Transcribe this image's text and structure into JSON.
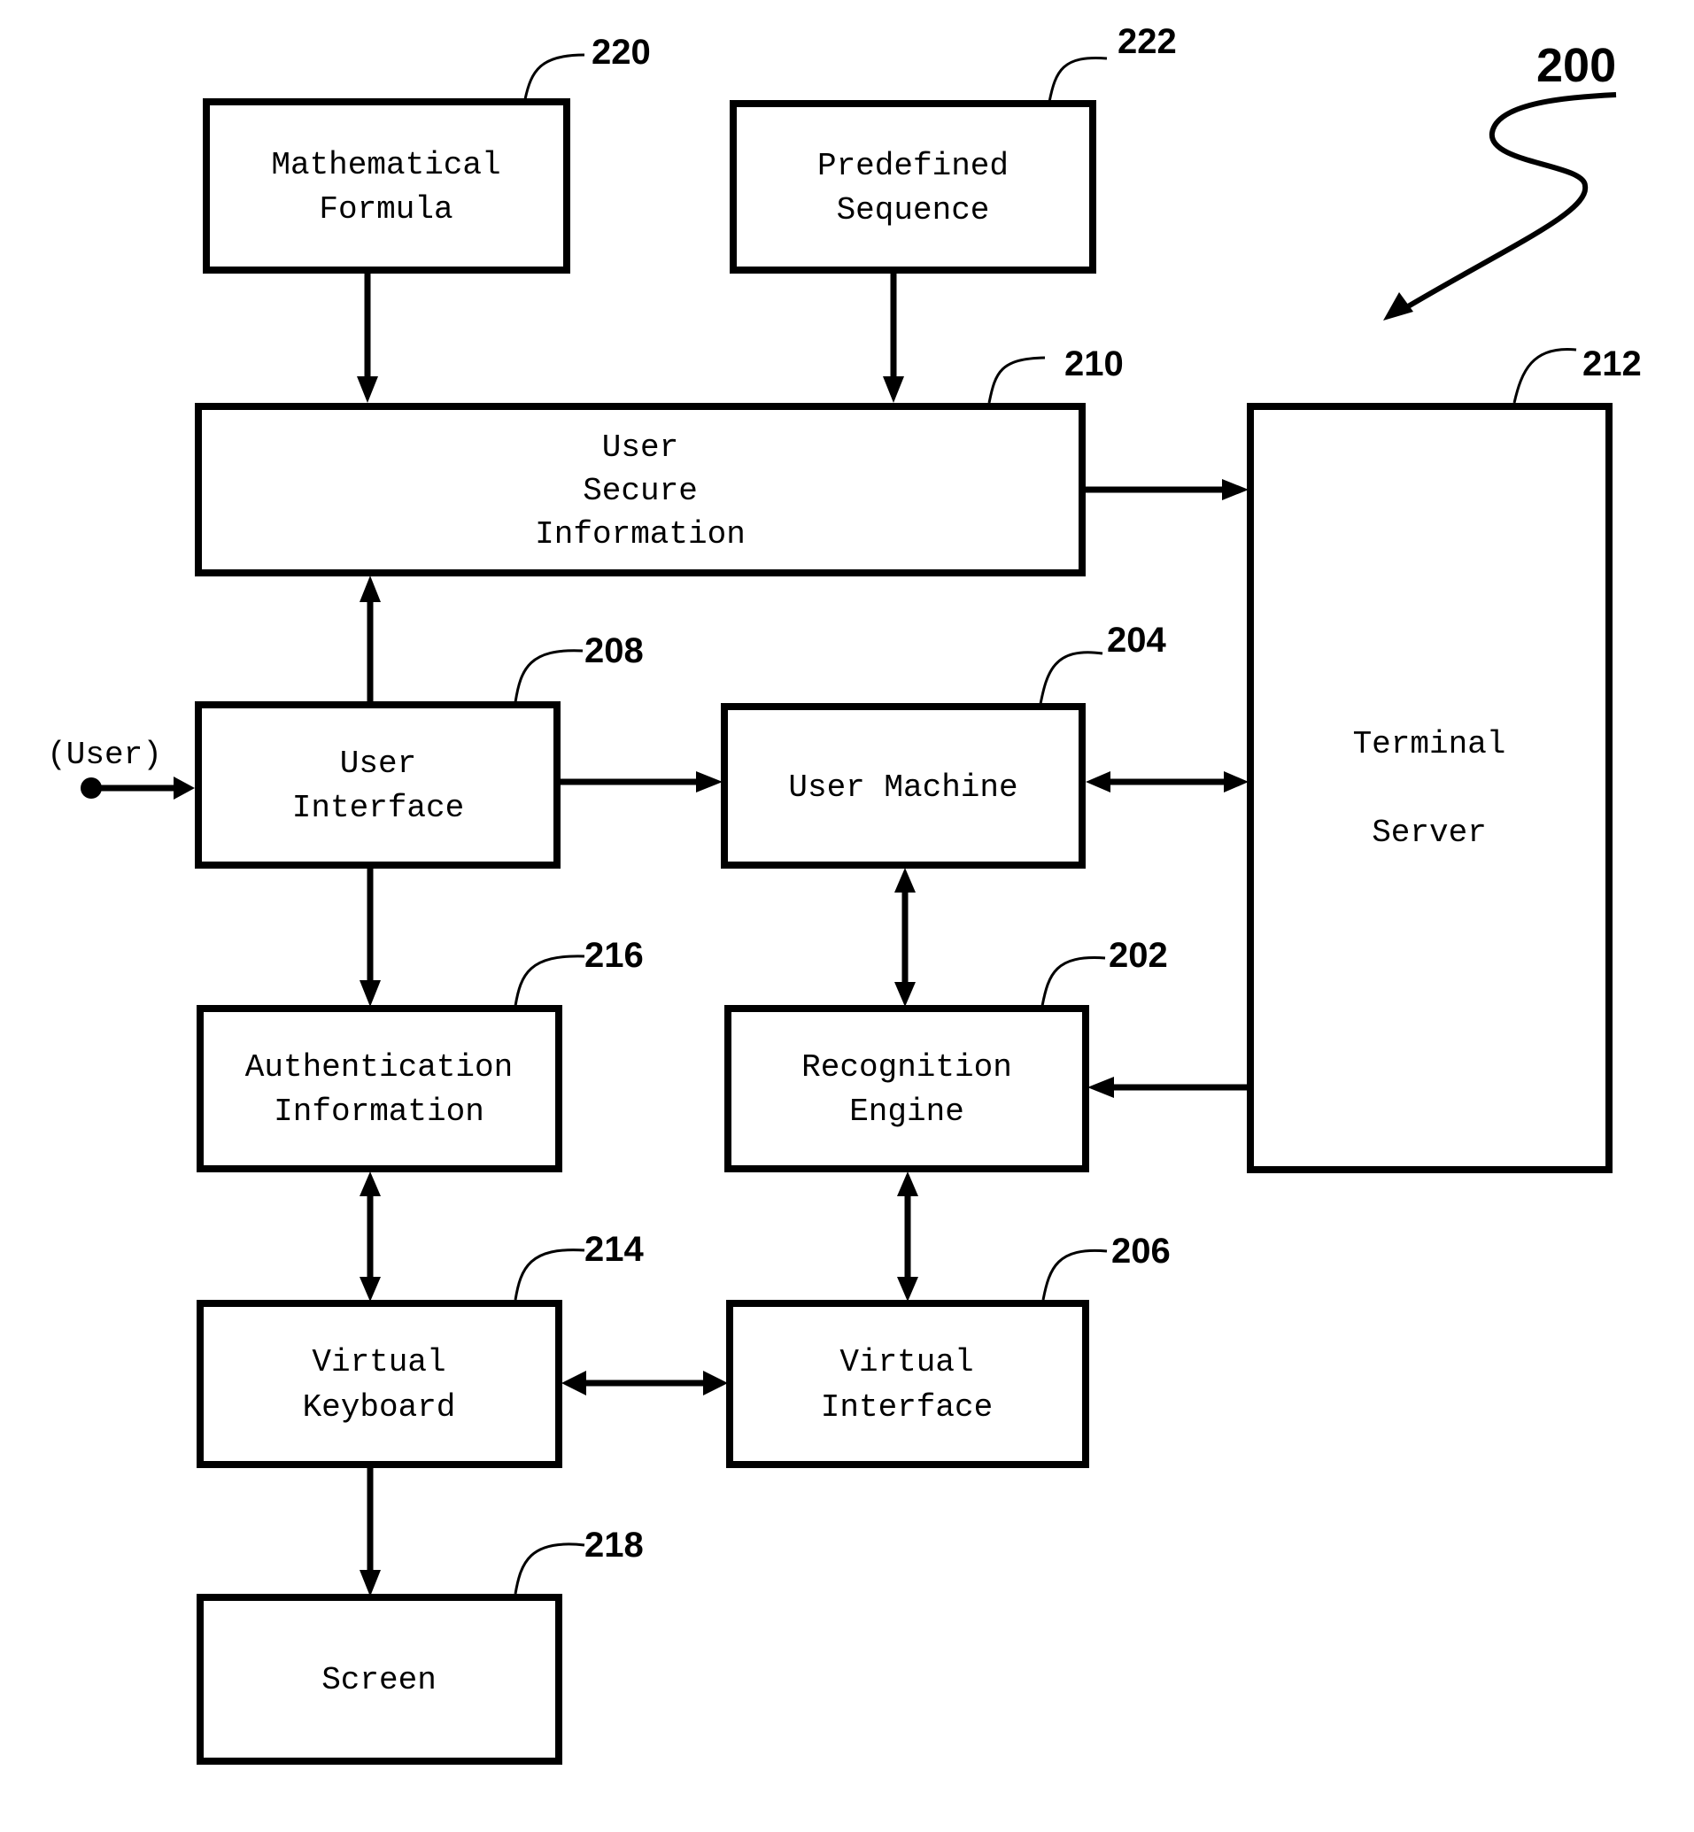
{
  "figure": {
    "reference": "200",
    "colors": {
      "ink": "#000000",
      "paper": "#ffffff"
    }
  },
  "blocks": {
    "mathematical_formula": {
      "ref": "220",
      "lines": [
        "Mathematical",
        "Formula"
      ]
    },
    "predefined_sequence": {
      "ref": "222",
      "lines": [
        "Predefined",
        "Sequence"
      ]
    },
    "user_secure_information": {
      "ref": "210",
      "lines": [
        "User",
        "Secure",
        "Information"
      ]
    },
    "terminal_server": {
      "ref": "212",
      "lines": [
        "Terminal",
        "Server"
      ]
    },
    "user_interface": {
      "ref": "208",
      "lines": [
        "User",
        "Interface"
      ]
    },
    "user_machine": {
      "ref": "204",
      "lines": [
        "User Machine"
      ]
    },
    "authentication_information": {
      "ref": "216",
      "lines": [
        "Authentication",
        "Information"
      ]
    },
    "recognition_engine": {
      "ref": "202",
      "lines": [
        "Recognition",
        "Engine"
      ]
    },
    "virtual_keyboard": {
      "ref": "214",
      "lines": [
        "Virtual",
        "Keyboard"
      ]
    },
    "virtual_interface": {
      "ref": "206",
      "lines": [
        "Virtual",
        "Interface"
      ]
    },
    "screen": {
      "ref": "218",
      "lines": [
        "Screen"
      ]
    }
  },
  "user_input_label": "(User)",
  "connections": [
    {
      "from": "mathematical_formula",
      "to": "user_secure_information",
      "direction": "one-way"
    },
    {
      "from": "predefined_sequence",
      "to": "user_secure_information",
      "direction": "one-way"
    },
    {
      "from": "user_secure_information",
      "to": "terminal_server",
      "direction": "one-way"
    },
    {
      "from": "user_interface",
      "to": "user_secure_information",
      "direction": "one-way"
    },
    {
      "from": "user",
      "to": "user_interface",
      "direction": "one-way"
    },
    {
      "from": "user_interface",
      "to": "user_machine",
      "direction": "one-way"
    },
    {
      "from": "user_machine",
      "to": "terminal_server",
      "direction": "two-way"
    },
    {
      "from": "user_interface",
      "to": "authentication_information",
      "direction": "one-way"
    },
    {
      "from": "user_machine",
      "to": "recognition_engine",
      "direction": "two-way"
    },
    {
      "from": "terminal_server",
      "to": "recognition_engine",
      "direction": "one-way"
    },
    {
      "from": "authentication_information",
      "to": "virtual_keyboard",
      "direction": "two-way"
    },
    {
      "from": "recognition_engine",
      "to": "virtual_interface",
      "direction": "two-way"
    },
    {
      "from": "virtual_keyboard",
      "to": "virtual_interface",
      "direction": "two-way"
    },
    {
      "from": "virtual_keyboard",
      "to": "screen",
      "direction": "one-way"
    }
  ]
}
